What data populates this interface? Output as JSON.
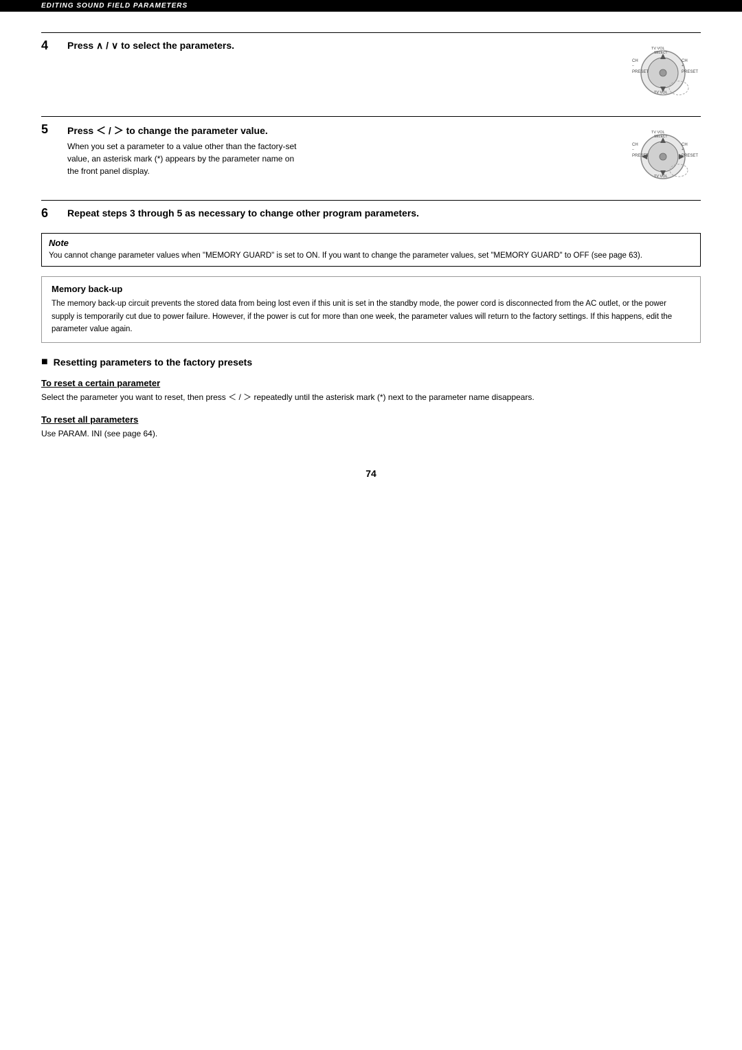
{
  "header": {
    "label": "EDITING SOUND FIELD PARAMETERS"
  },
  "steps": [
    {
      "number": "4",
      "title": "Press ∧ / ∨ to select the parameters.",
      "body": "",
      "has_image": true
    },
    {
      "number": "5",
      "title": "Press ＜ / ＞ to change the parameter value.",
      "body": "When you set a parameter to a value other than the factory-set value, an asterisk mark (*) appears by the parameter name on the front panel display.",
      "has_image": true
    },
    {
      "number": "6",
      "title": "Repeat steps 3 through 5 as necessary to change other program parameters.",
      "body": "",
      "has_image": false
    }
  ],
  "note": {
    "title": "Note",
    "text": "You cannot change parameter values when \"MEMORY GUARD\" is set to ON. If you want to change the parameter values, set \"MEMORY GUARD\" to OFF (see page 63)."
  },
  "memory_backup": {
    "title": "Memory back-up",
    "text": "The memory back-up circuit prevents the stored data from being lost even if this unit is set in the standby mode, the power cord is disconnected from the AC outlet, or the power supply is temporarily cut due to power failure. However, if the power is cut for more than one week, the parameter values will return to the factory settings. If this happens, edit the parameter value again."
  },
  "resetting_section": {
    "title": "Resetting parameters to the factory presets",
    "sub1_heading": "To reset a certain parameter",
    "sub1_text": "Select the parameter you want to reset, then press ＜ / ＞ repeatedly until the asterisk mark (*) next to the parameter name disappears.",
    "sub2_heading": "To reset all parameters",
    "sub2_text": "Use PARAM. INI (see page 64)."
  },
  "page_number": "74"
}
